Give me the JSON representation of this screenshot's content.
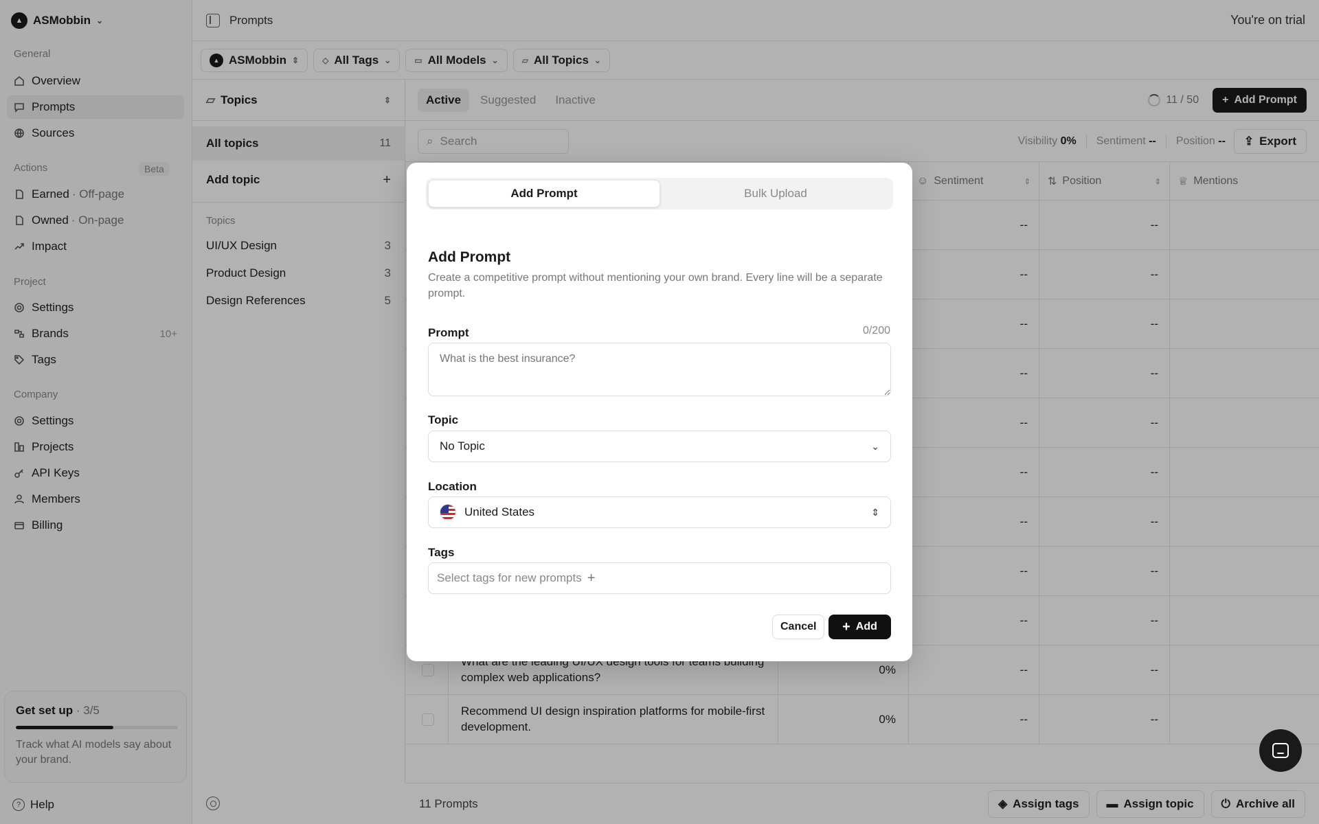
{
  "sidebar": {
    "org": "ASMobbin",
    "sections": {
      "general": "General",
      "actions": "Actions",
      "actions_badge": "Beta",
      "project": "Project",
      "company": "Company"
    },
    "nav": {
      "overview": "Overview",
      "prompts": "Prompts",
      "sources": "Sources",
      "earned": "Earned",
      "earned_sub": "· Off-page",
      "owned": "Owned",
      "owned_sub": "· On-page",
      "impact": "Impact",
      "project_settings": "Settings",
      "brands": "Brands",
      "brands_count": "10+",
      "tags": "Tags",
      "company_settings": "Settings",
      "projects": "Projects",
      "api_keys": "API Keys",
      "members": "Members",
      "billing": "Billing"
    },
    "setup": {
      "title": "Get set up",
      "step": "· 3/5",
      "progress": 0.6,
      "desc": "Track what AI models say about your brand."
    },
    "help": "Help"
  },
  "topbar": {
    "title": "Prompts",
    "trial": "You're on trial"
  },
  "filters": {
    "brand": "ASMobbin",
    "tags": "All Tags",
    "models": "All Models",
    "topics": "All Topics"
  },
  "topics_panel": {
    "header": "Topics",
    "all_label": "All topics",
    "all_count": "11",
    "add_label": "Add topic",
    "section_label": "Topics",
    "items": [
      {
        "label": "UI/UX Design",
        "count": "3"
      },
      {
        "label": "Product Design",
        "count": "3"
      },
      {
        "label": "Design References",
        "count": "5"
      }
    ]
  },
  "main": {
    "tabs": [
      "Active",
      "Suggested",
      "Inactive"
    ],
    "quota": "11 / 50",
    "add_prompt": "Add Prompt",
    "search_placeholder": "Search",
    "stats": {
      "visibility_label": "Visibility",
      "visibility_value": "0%",
      "sentiment_label": "Sentiment",
      "sentiment_value": "--",
      "position_label": "Position",
      "position_value": "--"
    },
    "export": "Export",
    "columns": {
      "sentiment": "Sentiment",
      "position": "Position",
      "mentions": "Mentions"
    },
    "rows": [
      {
        "prompt": "",
        "visibility": "%",
        "sentiment": "--",
        "position": "--"
      },
      {
        "prompt": "",
        "visibility": "%",
        "sentiment": "--",
        "position": "--"
      },
      {
        "prompt": "",
        "visibility": "%",
        "sentiment": "--",
        "position": "--"
      },
      {
        "prompt": "",
        "visibility": "%",
        "sentiment": "--",
        "position": "--"
      },
      {
        "prompt": "",
        "visibility": "%",
        "sentiment": "--",
        "position": "--"
      },
      {
        "prompt": "",
        "visibility": "%",
        "sentiment": "--",
        "position": "--"
      },
      {
        "prompt": "",
        "visibility": "%",
        "sentiment": "--",
        "position": "--"
      },
      {
        "prompt": "",
        "visibility": "%",
        "sentiment": "--",
        "position": "--"
      },
      {
        "prompt": "",
        "visibility": "%",
        "sentiment": "--",
        "position": "--"
      },
      {
        "prompt": "What are the leading UI/UX design tools for teams building complex web applications?",
        "visibility": "0%",
        "sentiment": "--",
        "position": "--"
      },
      {
        "prompt": "Recommend UI design inspiration platforms for mobile-first development.",
        "visibility": "0%",
        "sentiment": "--",
        "position": "--"
      }
    ],
    "footer": {
      "count": "11 Prompts",
      "assign_tags": "Assign tags",
      "assign_topic": "Assign topic",
      "archive_all": "Archive all"
    }
  },
  "modal": {
    "tabs": {
      "add": "Add Prompt",
      "bulk": "Bulk Upload"
    },
    "title": "Add Prompt",
    "description": "Create a competitive prompt without mentioning your own brand. Every line will be a separate prompt.",
    "prompt_label": "Prompt",
    "char_count": "0/200",
    "prompt_placeholder": "What is the best insurance?",
    "topic_label": "Topic",
    "topic_value": "No Topic",
    "location_label": "Location",
    "location_value": "United States",
    "tags_label": "Tags",
    "tags_placeholder": "Select tags for new prompts",
    "cancel": "Cancel",
    "add": "Add"
  }
}
